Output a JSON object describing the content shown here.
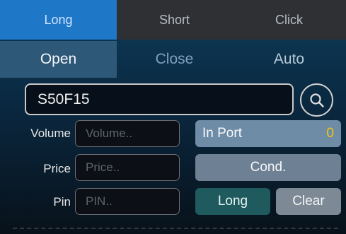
{
  "tabs_top": [
    "Long",
    "Short",
    "Click"
  ],
  "tabs_sub": [
    "Open",
    "Close",
    "Auto"
  ],
  "symbol": {
    "value": "S50F15"
  },
  "fields": {
    "volume": {
      "label": "Volume",
      "placeholder": "Volume.."
    },
    "price": {
      "label": "Price",
      "placeholder": "Price.."
    },
    "pin": {
      "label": "Pin",
      "placeholder": "PIN.."
    }
  },
  "buttons": {
    "in_port_label": "In Port",
    "in_port_count": "0",
    "cond": "Cond.",
    "long": "Long",
    "clear": "Clear"
  },
  "icons": {
    "search": "search-icon"
  },
  "colors": {
    "active_tab": "#1e77c7",
    "accent_count": "#f1c40f",
    "long_button": "#1f5a5e"
  }
}
